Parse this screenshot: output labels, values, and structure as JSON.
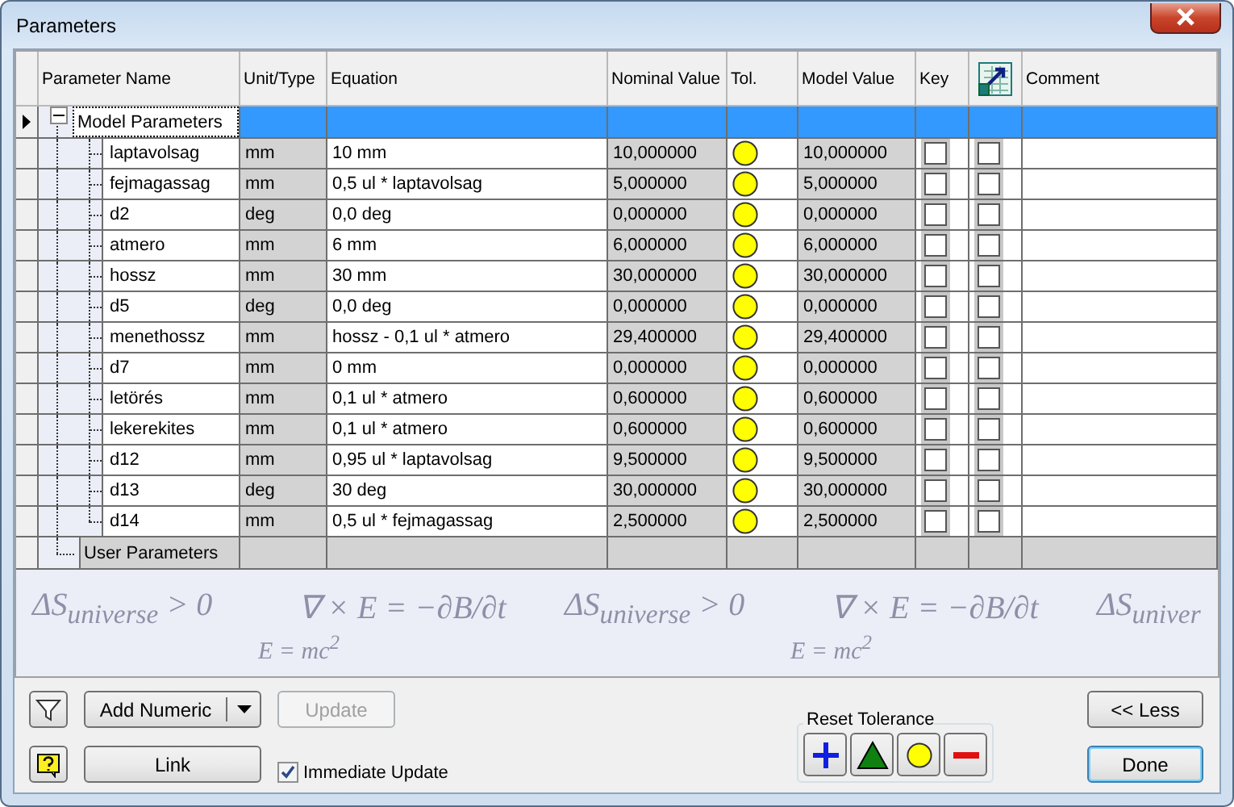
{
  "window": {
    "title": "Parameters"
  },
  "table": {
    "columns": [
      {
        "kind": "text",
        "label": "Parameter Name"
      },
      {
        "kind": "text",
        "label": "Unit/Type"
      },
      {
        "kind": "text",
        "label": "Equation"
      },
      {
        "kind": "text",
        "label": "Nominal Value"
      },
      {
        "kind": "text",
        "label": "Tol."
      },
      {
        "kind": "text",
        "label": "Model Value"
      },
      {
        "kind": "text",
        "label": "Key"
      },
      {
        "kind": "icon"
      },
      {
        "kind": "text",
        "label": "Comment"
      }
    ],
    "groups": [
      {
        "name": "Model Parameters",
        "selected": true,
        "expanded": true,
        "rows": [
          {
            "name": "laptavolsag",
            "unit": "mm",
            "equation": "10 mm",
            "nominal": "10,000000",
            "kind": "nominal",
            "model": "10,000000",
            "key": false,
            "export": false,
            "selected": false
          },
          {
            "name": "fejmagassag",
            "unit": "mm",
            "equation": "0,5 ul * laptavolsag",
            "nominal": "5,000000",
            "kind": "nominal",
            "model": "5,000000",
            "key": false,
            "export": false,
            "selected": false
          },
          {
            "name": "d2",
            "unit": "deg",
            "equation": "0,0 deg",
            "nominal": "0,000000",
            "kind": "nominal",
            "model": "0,000000",
            "key": false,
            "export": false,
            "selected": false
          },
          {
            "name": "atmero",
            "unit": "mm",
            "equation": "6 mm",
            "nominal": "6,000000",
            "kind": "nominal",
            "model": "6,000000",
            "key": false,
            "export": false,
            "selected": false
          },
          {
            "name": "hossz",
            "unit": "mm",
            "equation": "30 mm",
            "nominal": "30,000000",
            "kind": "nominal",
            "model": "30,000000",
            "key": false,
            "export": false,
            "selected": false
          },
          {
            "name": "d5",
            "unit": "deg",
            "equation": "0,0 deg",
            "nominal": "0,000000",
            "kind": "nominal",
            "model": "0,000000",
            "key": false,
            "export": false,
            "selected": false
          },
          {
            "name": "menethossz",
            "unit": "mm",
            "equation": "hossz - 0,1 ul * atmero",
            "nominal": "29,400000",
            "kind": "nominal",
            "model": "29,400000",
            "key": false,
            "export": false,
            "selected": false
          },
          {
            "name": "d7",
            "unit": "mm",
            "equation": "0 mm",
            "nominal": "0,000000",
            "kind": "nominal",
            "model": "0,000000",
            "key": false,
            "export": false,
            "selected": false
          },
          {
            "name": "letörés",
            "unit": "mm",
            "equation": "0,1 ul * atmero",
            "nominal": "0,600000",
            "kind": "nominal",
            "model": "0,600000",
            "key": false,
            "export": false,
            "selected": false
          },
          {
            "name": "lekerekites",
            "unit": "mm",
            "equation": "0,1 ul * atmero",
            "nominal": "0,600000",
            "kind": "nominal",
            "model": "0,600000",
            "key": false,
            "export": false,
            "selected": false
          },
          {
            "name": "d12",
            "unit": "mm",
            "equation": "0,95 ul * laptavolsag",
            "nominal": "9,500000",
            "kind": "nominal",
            "model": "9,500000",
            "key": false,
            "export": false,
            "selected": false
          },
          {
            "name": "d13",
            "unit": "deg",
            "equation": "30 deg",
            "nominal": "30,000000",
            "kind": "nominal",
            "model": "30,000000",
            "key": false,
            "export": false,
            "selected": false
          },
          {
            "name": "d14",
            "unit": "mm",
            "equation": "0,5 ul * fejmagassag",
            "nominal": "2,500000",
            "kind": "nominal",
            "model": "2,500000",
            "key": false,
            "export": false,
            "selected": false
          }
        ]
      },
      {
        "name": "User Parameters",
        "selected": false
      }
    ]
  },
  "background_formulas": [
    "ΔS$_{universe}$ > 0",
    "∇ × E = −∂B/∂t",
    "ΔS$_{universe}$ > 0",
    "∇ × E = −∂B/∂t",
    "ΔS$_{univer}$"
  ],
  "background_formulas_lower": [
    "E = mc$^{2}$",
    "E = mc$^{2}$"
  ],
  "footer": {
    "add_numeric": "Add Numeric",
    "update": {
      "label": "Update",
      "disabled": true
    },
    "link": "Link",
    "immediate_update": {
      "label": "Immediate Update",
      "checked": true
    },
    "reset_tolerance": {
      "label": "Reset Tolerance",
      "buttons": [
        {
          "kind": "upper"
        },
        {
          "kind": "median"
        },
        {
          "kind": "nominal"
        },
        {
          "kind": "lower"
        }
      ]
    },
    "less": "<< Less",
    "done": "Done"
  }
}
